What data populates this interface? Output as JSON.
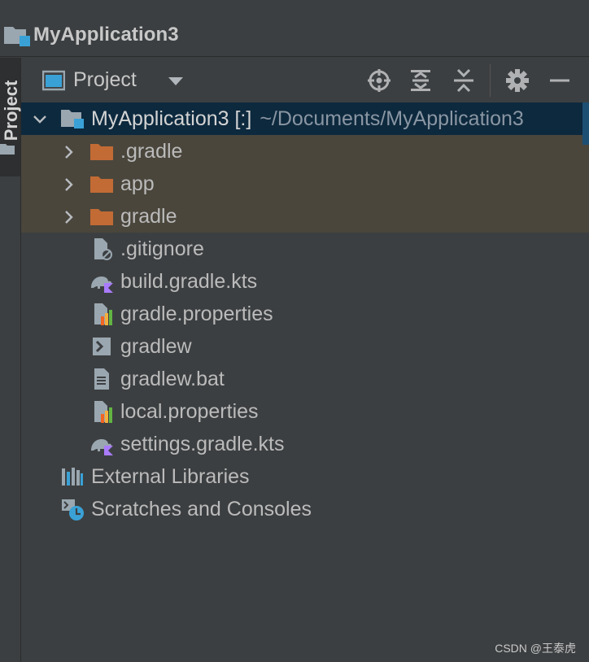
{
  "window": {
    "title": "MyApplication3"
  },
  "tool_strip": {
    "tab_label": "Project"
  },
  "panel": {
    "view_title": "Project",
    "buttons": [
      "locate-icon",
      "expand-all-icon",
      "collapse-all-icon",
      "gear-icon",
      "minimize-icon"
    ]
  },
  "tree": {
    "root": {
      "label": "MyApplication3 [:]",
      "path": "~/Documents/MyApplication3"
    },
    "folders": [
      {
        "label": ".gradle"
      },
      {
        "label": "app"
      },
      {
        "label": "gradle"
      }
    ],
    "files": [
      {
        "label": ".gitignore",
        "icon": "gitignore-file-icon"
      },
      {
        "label": "build.gradle.kts",
        "icon": "gradle-kts-file-icon"
      },
      {
        "label": "gradle.properties",
        "icon": "properties-file-icon"
      },
      {
        "label": "gradlew",
        "icon": "shell-script-file-icon"
      },
      {
        "label": "gradlew.bat",
        "icon": "text-file-icon"
      },
      {
        "label": "local.properties",
        "icon": "properties-file-icon"
      },
      {
        "label": "settings.gradle.kts",
        "icon": "gradle-kts-file-icon"
      }
    ],
    "external_libraries": "External Libraries",
    "scratches": "Scratches and Consoles"
  },
  "watermark": "CSDN @王泰虎",
  "colors": {
    "background": "#3c3f41",
    "selection": "#0d293e",
    "excluded_folder": "#4a463c",
    "folder_orange": "#c26b35",
    "accent_blue": "#3aa1d6"
  }
}
